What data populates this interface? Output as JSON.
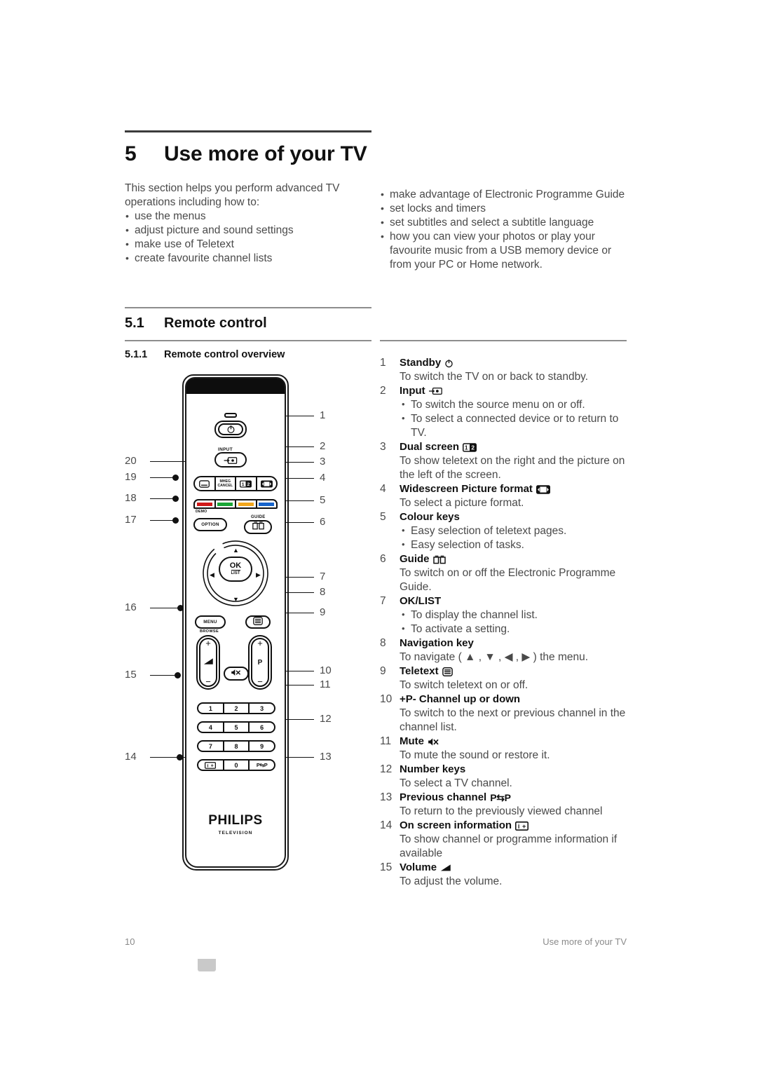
{
  "chapter": {
    "number": "5",
    "title": "Use more of your TV"
  },
  "intro": {
    "lead": "This section helps you perform advanced TV operations including how to:",
    "left_bullets": [
      "use the menus",
      "adjust picture and sound settings",
      "make use of Teletext",
      "create favourite channel lists"
    ],
    "right_bullets": [
      "make advantage of Electronic Programme Guide",
      "set locks and timers",
      "set subtitles and select a subtitle language",
      "how you can view your photos or play your favourite music from a USB memory device or from your PC or Home network."
    ]
  },
  "section": {
    "number": "5.1",
    "title": "Remote control"
  },
  "subsection": {
    "number": "5.1.1",
    "title": "Remote control overview"
  },
  "keys": [
    {
      "index": "1",
      "name": "Standby",
      "icon": "power-icon",
      "desc": "To switch the TV on or back to standby.",
      "bullets": []
    },
    {
      "index": "2",
      "name": "Input",
      "icon": "input-icon",
      "desc": "",
      "bullets": [
        "To switch the source menu on or off.",
        "To select a connected device or to return to TV."
      ]
    },
    {
      "index": "3",
      "name": "Dual screen",
      "icon": "dual-screen-icon",
      "desc": "To show teletext on the right and the picture on the left of the screen.",
      "bullets": []
    },
    {
      "index": "4",
      "name": "Widescreen Picture format",
      "icon": "widescreen-icon",
      "desc": "To select a picture format.",
      "bullets": []
    },
    {
      "index": "5",
      "name": "Colour keys",
      "icon": "",
      "desc": "",
      "bullets": [
        "Easy selection of teletext pages.",
        "Easy selection of tasks."
      ]
    },
    {
      "index": "6",
      "name": "Guide",
      "icon": "guide-book-icon",
      "desc": "To switch on or off the Electronic Programme Guide.",
      "bullets": []
    },
    {
      "index": "7",
      "name": "OK/LIST",
      "icon": "",
      "desc": "",
      "bullets": [
        "To display the channel list.",
        "To activate a setting."
      ]
    },
    {
      "index": "8",
      "name": "Navigation key",
      "icon": "",
      "desc": "To navigate ( ▲ , ▼ , ◀ , ▶ ) the menu.",
      "bullets": []
    },
    {
      "index": "9",
      "name": "Teletext",
      "icon": "teletext-icon",
      "desc": "To switch teletext on or off.",
      "bullets": []
    },
    {
      "index": "10",
      "name": "+P-  Channel up or down",
      "icon": "",
      "desc": "To switch to the next or previous channel in the channel list.",
      "bullets": []
    },
    {
      "index": "11",
      "name": "Mute",
      "icon": "mute-icon",
      "desc": "To mute the sound or restore it.",
      "bullets": []
    },
    {
      "index": "12",
      "name": "Number keys",
      "icon": "",
      "desc": "To select a TV channel.",
      "bullets": []
    },
    {
      "index": "13",
      "name": "Previous channel",
      "icon": "previous-channel-icon",
      "desc": "To return to the previously viewed channel",
      "bullets": []
    },
    {
      "index": "14",
      "name": "On screen information",
      "icon": "info-plus-icon",
      "desc": "To show channel or programme information if available",
      "bullets": []
    },
    {
      "index": "15",
      "name": "Volume",
      "icon": "volume-icon",
      "desc": "To adjust the volume.",
      "bullets": []
    }
  ],
  "remote": {
    "brand": "PHILIPS",
    "brand_sub": "TELEVISION",
    "labels": {
      "input": "INPUT",
      "mheg": "MHEG\nCANCEL",
      "demo": "DEMO",
      "option": "OPTION",
      "guide": "GUIDE",
      "menu": "MENU",
      "browse": "BROWSE",
      "ok": "OK",
      "list": "LIST",
      "p": "P",
      "plus": "+",
      "minus": "−",
      "prev_channel": "P⇆P",
      "dual_1": "1",
      "dual_2": "2",
      "info": "i+"
    },
    "colour_keys": [
      "#d01919",
      "#1aa636",
      "#f2a61c",
      "#1664cc"
    ],
    "number_rows": [
      [
        "1",
        "2",
        "3"
      ],
      [
        "4",
        "5",
        "6"
      ],
      [
        "7",
        "8",
        "9"
      ]
    ],
    "bottom_row": [
      "i+",
      "0",
      "P⇆P"
    ],
    "callouts_right": [
      "1",
      "2",
      "3",
      "4",
      "5",
      "6",
      "7",
      "8",
      "9",
      "10",
      "11",
      "12",
      "13"
    ],
    "callouts_left": [
      "20",
      "19",
      "18",
      "17",
      "16",
      "15",
      "14"
    ]
  },
  "footer": {
    "page_number": "10",
    "running_head": "Use more of your TV"
  }
}
